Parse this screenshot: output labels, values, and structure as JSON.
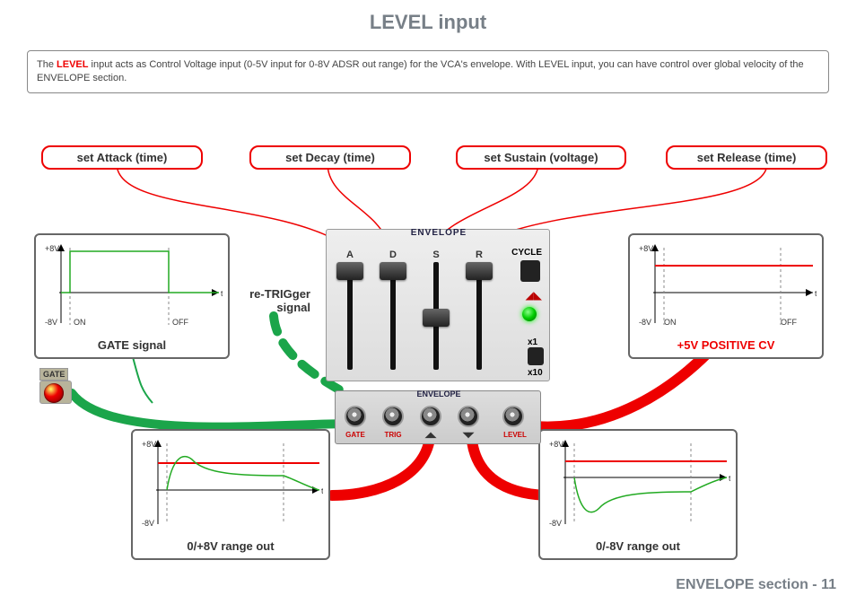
{
  "title": "LEVEL input",
  "description": {
    "prefix": "The ",
    "keyword": "LEVEL",
    "rest": " input acts as Control Voltage input (0-5V input for 0-8V ADSR out range) for the VCA's envelope. With LEVEL input, you can have control over global velocity of the ENVELOPE section."
  },
  "pills": {
    "attack": "set Attack (time)",
    "decay": "set Decay (time)",
    "sustain": "set Sustain (voltage)",
    "release": "set Release (time)"
  },
  "retrig_line1": "re-TRIGger",
  "retrig_line2": "signal",
  "gate_label": "GATE",
  "graphs": {
    "gate": {
      "caption": "GATE signal",
      "hi": "+8V",
      "lo": "-8V",
      "on": "ON",
      "off": "OFF"
    },
    "cv": {
      "caption": "+5V POSITIVE CV",
      "hi": "+8V",
      "lo": "-8V",
      "on": "ON",
      "off": "OFF"
    },
    "posout": {
      "caption": "0/+8V range out",
      "hi": "+8V",
      "lo": "-8V"
    },
    "negout": {
      "caption": "0/-8V range out",
      "hi": "+8V",
      "lo": "-8V"
    }
  },
  "panel": {
    "title": "ENVELOPE",
    "a": "A",
    "d": "D",
    "s": "S",
    "r": "R",
    "cycle": "CYCLE",
    "x1": "x1",
    "x10": "x10",
    "bottom_title": "ENVELOPE",
    "j_gate": "GATE",
    "j_trig": "TRIG",
    "j_env1": "",
    "j_env2": "",
    "j_level": "LEVEL"
  },
  "footer": "ENVELOPE section - 11"
}
